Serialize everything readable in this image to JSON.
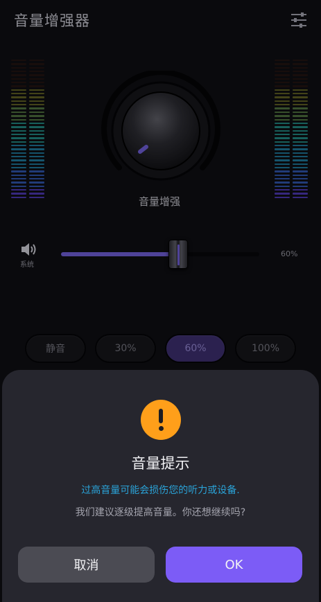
{
  "app": {
    "title": "音量增强器",
    "settings_icon": "sliders-icon"
  },
  "knob": {
    "label": "音量增强"
  },
  "system_volume": {
    "icon": "speaker-icon",
    "label": "系统",
    "value_text": "60%",
    "level": 0.6
  },
  "presets": [
    {
      "label": "静音",
      "active": false
    },
    {
      "label": "30%",
      "active": false
    },
    {
      "label": "60%",
      "active": true
    },
    {
      "label": "100%",
      "active": false
    }
  ],
  "dialog": {
    "icon": "warning-icon",
    "title": "音量提示",
    "warning": "过高音量可能会损伤您的听力或设备.",
    "body": "我们建议逐级提高音量。你还想继续吗?",
    "cancel_label": "取消",
    "ok_label": "OK"
  },
  "colors": {
    "accent": "#7c5cf6",
    "warning": "#ff9f1a",
    "warning_text": "#2aa3d8"
  }
}
